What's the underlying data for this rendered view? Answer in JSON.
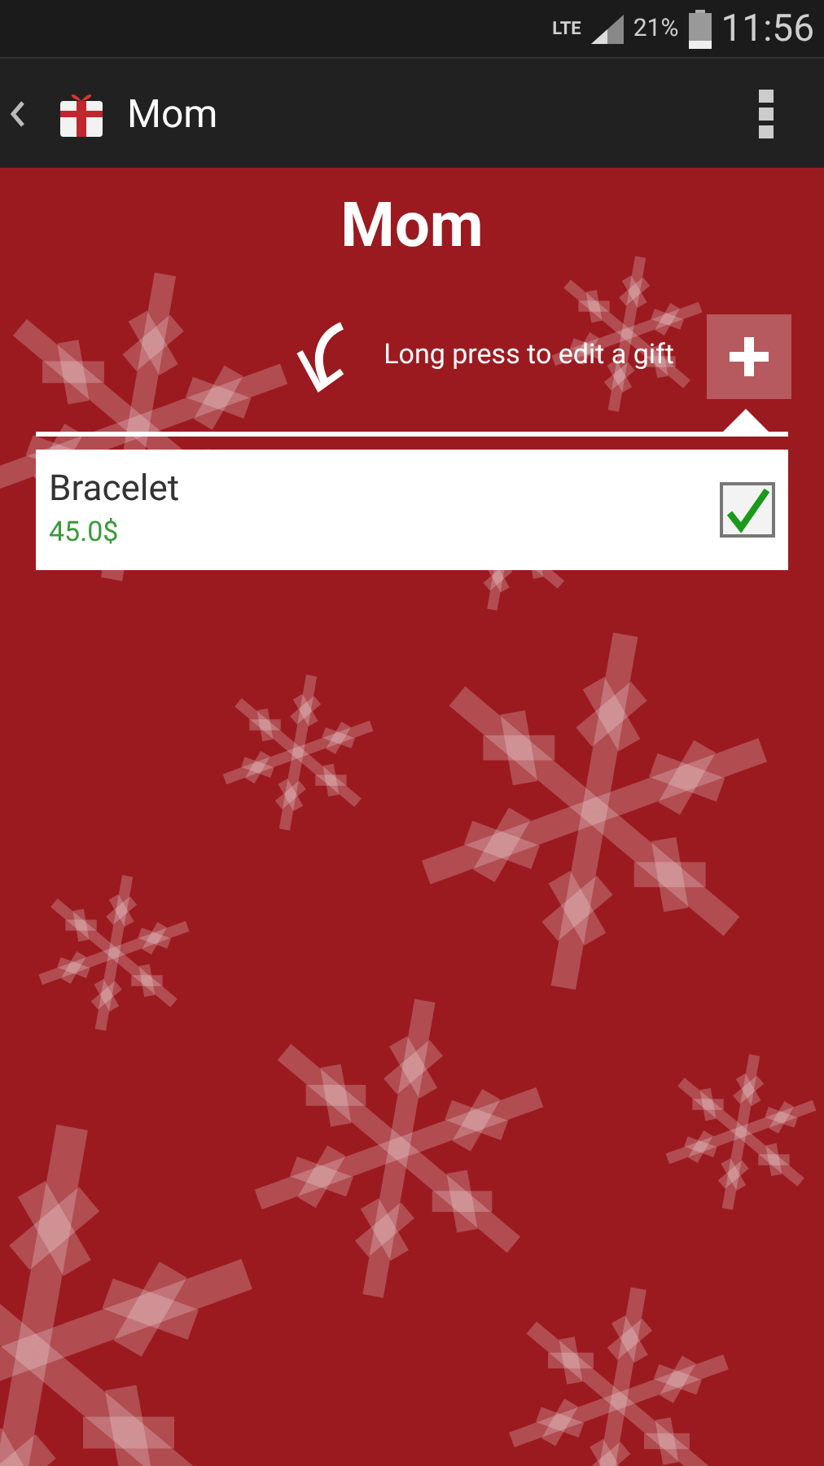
{
  "status_bar": {
    "network": "LTE",
    "battery": "21%",
    "time": "11:56"
  },
  "action_bar": {
    "title": "Mom"
  },
  "heading": "Mom",
  "hint": "Long press to edit a gift",
  "gifts": [
    {
      "name": "Bracelet",
      "price": "45.0$",
      "checked": true
    }
  ]
}
